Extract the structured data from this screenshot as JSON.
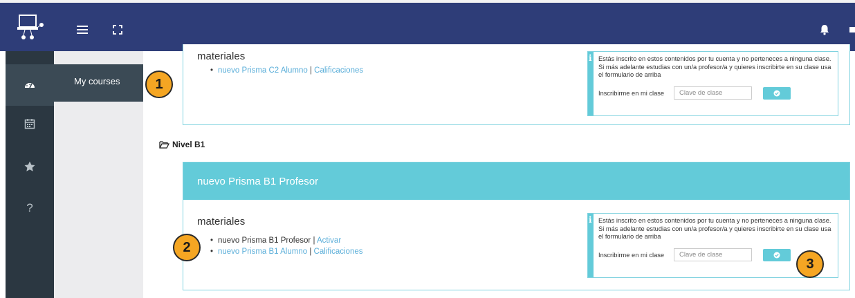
{
  "sidebar": {
    "items": [
      {
        "icon": "dashboard-icon"
      },
      {
        "icon": "calendar-icon"
      },
      {
        "icon": "star-icon"
      },
      {
        "icon": "help-icon",
        "label": "?"
      }
    ],
    "flyout_label": "My courses"
  },
  "courses": [
    {
      "materials_title": "materiales",
      "materials": [
        {
          "name": "nuevo Prisma C2 Alumno",
          "name_is_link": true,
          "sep": "|",
          "action": "Calificaciones"
        }
      ],
      "info_text": "Estás inscrito en estos contenidos por tu cuenta y no perteneces a ninguna clase. Si más adelante estudias con un/a profesor/a y quieres inscribirte en su clase usa el formulario de arriba",
      "enroll_label": "Inscribirme en mi clase",
      "enroll_placeholder": "Clave de clase"
    },
    {
      "title": "nuevo Prisma B1 Profesor",
      "materials_title": "materiales",
      "materials": [
        {
          "name": "nuevo Prisma B1 Profesor",
          "name_is_link": false,
          "sep": "|",
          "action": "Activar"
        },
        {
          "name": "nuevo Prisma B1 Alumno",
          "name_is_link": true,
          "sep": "|",
          "action": "Calificaciones"
        }
      ],
      "info_text": "Estás inscrito en estos contenidos por tu cuenta y no perteneces a ninguna clase. Si más adelante estudias con un/a profesor/a y quieres inscribirte en su clase usa el formulario de arriba",
      "enroll_label": "Inscribirme en mi clase",
      "enroll_placeholder": "Clave de clase"
    }
  ],
  "level_heading": "Nivel B1",
  "callouts": [
    "1",
    "2",
    "3"
  ],
  "colors": {
    "topbar": "#2e3d78",
    "rail": "#2b3741",
    "accent": "#63cbd9",
    "link": "#5aaed9",
    "badge": "#f5a623"
  }
}
